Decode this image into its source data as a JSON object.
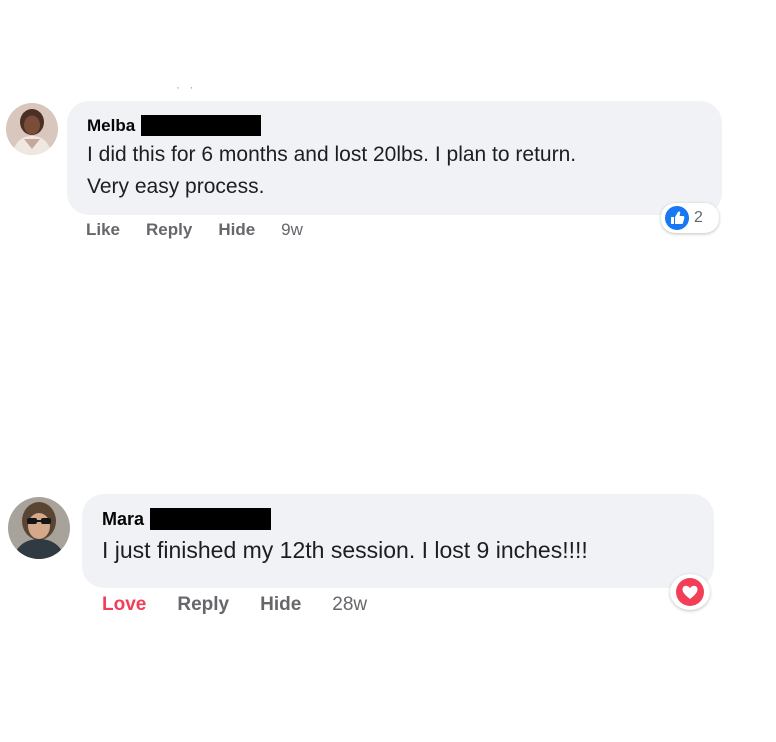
{
  "top_ellipsis": "· ·",
  "comments": [
    {
      "author": "Melba",
      "text_line1": "I did this for 6 months and lost 20lbs. I plan to return.",
      "text_line2": "Very easy process.",
      "actions": {
        "like": "Like",
        "reply": "Reply",
        "hide": "Hide",
        "time": "9w"
      },
      "reaction": {
        "type": "like",
        "count": "2",
        "color": "#1877f2"
      },
      "avatar_icon": "profile-photo"
    },
    {
      "author": "Mara",
      "text": "I just finished my 12th session. I lost 9 inches!!!!",
      "actions": {
        "like": "Love",
        "reply": "Reply",
        "hide": "Hide",
        "time": "28w"
      },
      "reaction": {
        "type": "love",
        "color": "#f33e58"
      },
      "avatar_icon": "profile-photo"
    }
  ],
  "colors": {
    "bubble_bg": "#f0f2f5",
    "action_text": "#65676b",
    "love_text": "#f33e58",
    "like_blue": "#1877f2"
  }
}
